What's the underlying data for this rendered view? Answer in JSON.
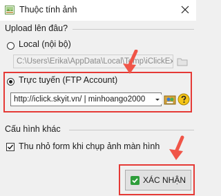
{
  "window": {
    "title": "Thuộc tính ảnh",
    "close_icon": "close-icon",
    "app_icon": "image-icon"
  },
  "upload": {
    "section_title": "Upload lên đâu?",
    "local_label": "Local (nội bộ)",
    "local_path": "C:\\Users\\Erika\\AppData\\Local\\Temp\\iClickEx",
    "online_label": "Trực tuyến (FTP Account)",
    "ftp_account": "http://iclick.skyit.vn/ | minhoango2000",
    "selected": "online"
  },
  "other": {
    "section_title": "Cấu hình khác",
    "minimize_label": "Thu nhỏ form khi chụp ảnh màn hình",
    "minimize_checked": true
  },
  "confirm": {
    "label": "XÁC NHẬN"
  },
  "colors": {
    "highlight": "#e53935",
    "arrow": "#f05548",
    "accent_green": "#2e9e3a"
  }
}
